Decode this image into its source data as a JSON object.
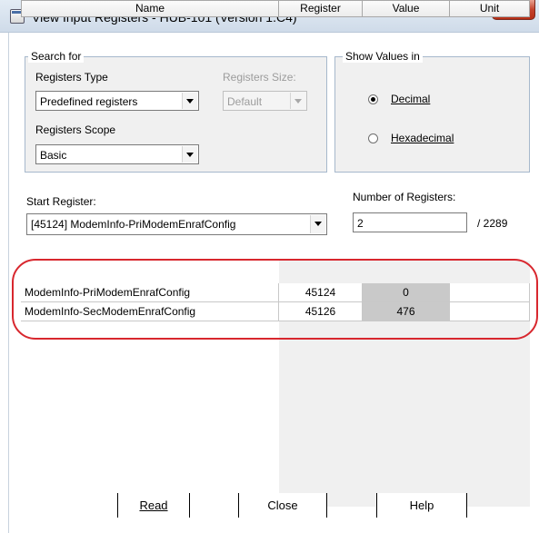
{
  "window": {
    "title": "View Input Registers - HUB-101 (Version 1.C4)",
    "close_glyph": "X"
  },
  "search_for": {
    "group_title": "Search for",
    "registers_type_label": "Registers Type",
    "registers_type_value": "Predefined registers",
    "registers_size_label": "Registers Size:",
    "registers_size_value": "Default",
    "registers_scope_label": "Registers Scope",
    "registers_scope_value": "Basic"
  },
  "show_values": {
    "group_title": "Show Values in",
    "options": [
      {
        "label": "Decimal",
        "selected": true
      },
      {
        "label": "Hexadecimal",
        "selected": false
      }
    ]
  },
  "start_register": {
    "label": "Start Register:",
    "value": "[45124] ModemInfo-PriModemEnrafConfig"
  },
  "number_of_registers": {
    "label": "Number of Registers:",
    "value": "2",
    "total": "/ 2289"
  },
  "table": {
    "columns": [
      "Name",
      "Register",
      "Value",
      "Unit"
    ],
    "rows": [
      {
        "name": "ModemInfo-PriModemEnrafConfig",
        "register": "45124",
        "value": "0",
        "unit": ""
      },
      {
        "name": "ModemInfo-SecModemEnrafConfig",
        "register": "45126",
        "value": "476",
        "unit": ""
      }
    ]
  },
  "buttons": {
    "read": "Read",
    "close": "Close",
    "help": "Help"
  },
  "colors": {
    "highlight": "#d8272e",
    "close_button": "#c4432d",
    "value_cell": "#c9c9c9"
  }
}
